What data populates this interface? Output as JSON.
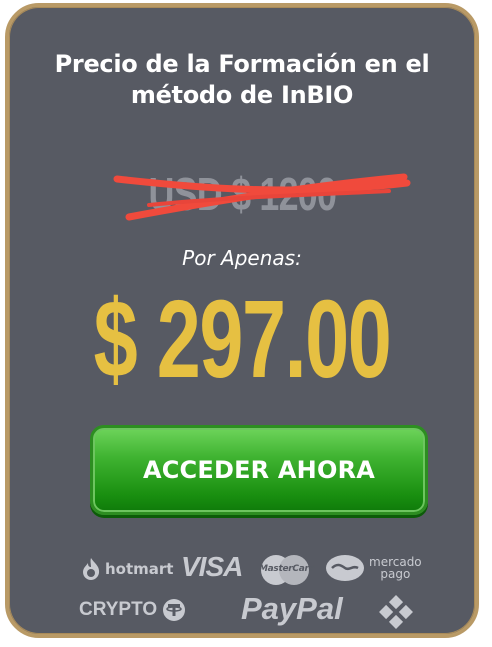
{
  "title": "Precio de la Formación en el método de InBIO",
  "old_price": "USD $ 1200",
  "subtitle": "Por Apenas:",
  "price": "$ 297.00",
  "cta_label": "ACCEDER AHORA",
  "colors": {
    "card_bg": "#575a63",
    "border": "#b99a66",
    "price": "#e6c042",
    "strike": "#f04a3c",
    "button_green": "#2aa51e"
  },
  "payment_logos": {
    "hotmart": "hotmart",
    "visa": "VISA",
    "mastercard": "MasterCard",
    "mercadopago_line1": "mercado",
    "mercadopago_line2": "pago",
    "crypto": "CRYPTO",
    "paypal": "PayPal",
    "icons": [
      "hotmart-flame-icon",
      "mastercard-circles-icon",
      "handshake-icon",
      "tether-icon",
      "binance-icon"
    ]
  }
}
